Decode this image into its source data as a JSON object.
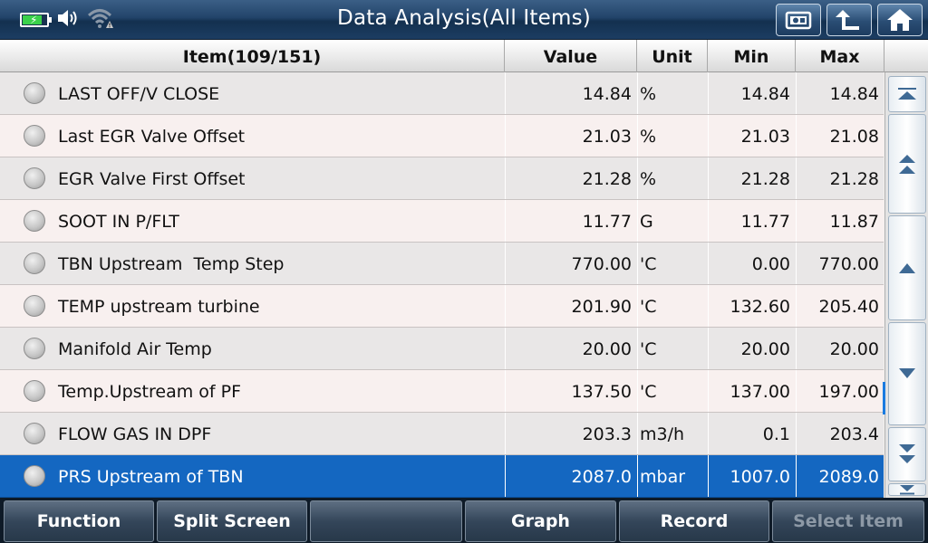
{
  "title": "Data Analysis(All Items)",
  "colors": {
    "accent": "#1467c1",
    "battery": "#3ad14a",
    "titlebar": "#22446a"
  },
  "status": {
    "battery_level_fraction": 0.8,
    "icons": [
      "battery-icon",
      "speaker-icon",
      "wifi-warning-icon"
    ]
  },
  "top_buttons": [
    {
      "icon": "screenshot-icon"
    },
    {
      "icon": "back-up-arrow-icon"
    },
    {
      "icon": "home-icon"
    }
  ],
  "table": {
    "headers": {
      "item": "Item(109/151)",
      "value": "Value",
      "unit": "Unit",
      "min": "Min",
      "max": "Max"
    },
    "rows": [
      {
        "name": "LAST OFF/V CLOSE",
        "value": "14.84",
        "unit": "%",
        "min": "14.84",
        "max": "14.84"
      },
      {
        "name": "Last EGR Valve Offset",
        "value": "21.03",
        "unit": "%",
        "min": "21.03",
        "max": "21.08"
      },
      {
        "name": "EGR Valve First Offset",
        "value": "21.28",
        "unit": "%",
        "min": "21.28",
        "max": "21.28"
      },
      {
        "name": "SOOT IN P/FLT",
        "value": "11.77",
        "unit": "G",
        "min": "11.77",
        "max": "11.87"
      },
      {
        "name": "TBN Upstream  Temp Step",
        "value": "770.00",
        "unit": "'C",
        "min": "0.00",
        "max": "770.00"
      },
      {
        "name": "TEMP upstream turbine",
        "value": "201.90",
        "unit": "'C",
        "min": "132.60",
        "max": "205.40"
      },
      {
        "name": "Manifold Air Temp",
        "value": "20.00",
        "unit": "'C",
        "min": "20.00",
        "max": "20.00"
      },
      {
        "name": "Temp.Upstream of PF",
        "value": "137.50",
        "unit": "'C",
        "min": "137.00",
        "max": "197.00"
      },
      {
        "name": "FLOW GAS IN DPF",
        "value": "203.3",
        "unit": "m3/h",
        "min": "0.1",
        "max": "203.4"
      },
      {
        "name": "PRS Upstream of TBN",
        "value": "2087.0",
        "unit": "mbar",
        "min": "1007.0",
        "max": "2089.0"
      }
    ],
    "selected_index": 9
  },
  "scroll_buttons": [
    {
      "icon": "scroll-top-icon"
    },
    {
      "icon": "page-up-icon"
    },
    {
      "icon": "line-up-icon"
    },
    {
      "icon": "line-down-icon"
    },
    {
      "icon": "page-down-icon"
    },
    {
      "icon": "scroll-bottom-icon"
    }
  ],
  "bottom_buttons": [
    {
      "label": "Function",
      "enabled": true
    },
    {
      "label": "Split Screen",
      "enabled": true
    },
    {
      "label": "",
      "enabled": false
    },
    {
      "label": "Graph",
      "enabled": true
    },
    {
      "label": "Record",
      "enabled": true
    },
    {
      "label": "Select Item",
      "enabled": false
    }
  ]
}
